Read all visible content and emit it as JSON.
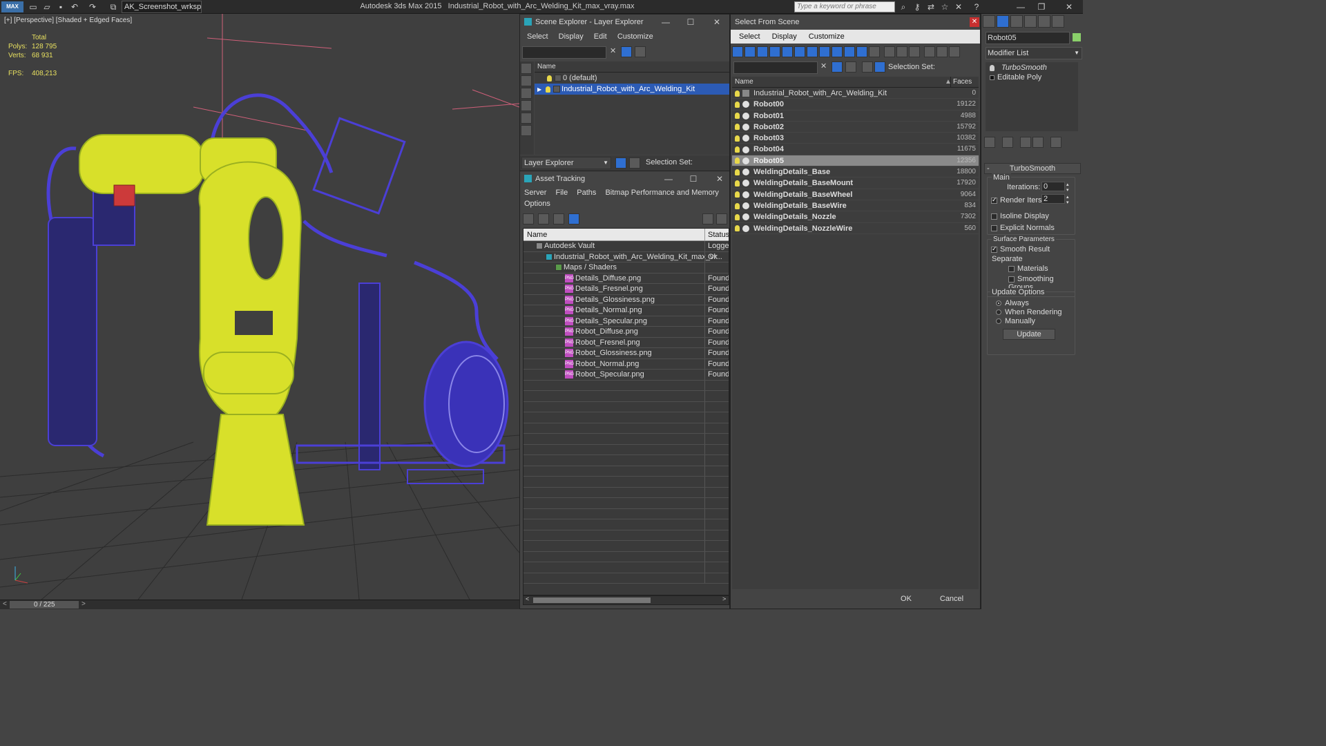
{
  "titlebar": {
    "app_logo": "MAX",
    "workspace": "AK_Screenshot_wrksp",
    "app_title": "Autodesk 3ds Max  2015",
    "file_title": "Industrial_Robot_with_Arc_Welding_Kit_max_vray.max",
    "search_placeholder": "Type a keyword or phrase"
  },
  "viewport": {
    "label": "[+] [Perspective] [Shaded + Edged Faces]",
    "stats_header": "Total",
    "polys_label": "Polys:",
    "polys_value": "128 795",
    "verts_label": "Verts:",
    "verts_value": "68 931",
    "fps_label": "FPS:",
    "fps_value": "408,213"
  },
  "timeline": {
    "frame": "0 / 225"
  },
  "scene_explorer": {
    "title": "Scene Explorer - Layer Explorer",
    "menus": [
      "Select",
      "Display",
      "Edit",
      "Customize"
    ],
    "column_name": "Name",
    "layers": [
      "0 (default)",
      "Industrial_Robot_with_Arc_Welding_Kit"
    ],
    "footer_dropdown": "Layer Explorer",
    "footer_selection_set": "Selection Set:"
  },
  "asset_tracking": {
    "title": "Asset Tracking",
    "menus": [
      "Server",
      "File",
      "Paths",
      "Bitmap Performance and Memory",
      "Options"
    ],
    "col_name": "Name",
    "col_status": "Status",
    "rows": [
      {
        "name": "Autodesk Vault",
        "status": "Logged",
        "indent": 0
      },
      {
        "name": "Industrial_Robot_with_Arc_Welding_Kit_max_vr...",
        "status": "Ok",
        "indent": 1
      },
      {
        "name": "Maps / Shaders",
        "status": "",
        "indent": 2
      },
      {
        "name": "Details_Diffuse.png",
        "status": "Found",
        "indent": 3
      },
      {
        "name": "Details_Fresnel.png",
        "status": "Found",
        "indent": 3
      },
      {
        "name": "Details_Glossiness.png",
        "status": "Found",
        "indent": 3
      },
      {
        "name": "Details_Normal.png",
        "status": "Found",
        "indent": 3
      },
      {
        "name": "Details_Specular.png",
        "status": "Found",
        "indent": 3
      },
      {
        "name": "Robot_Diffuse.png",
        "status": "Found",
        "indent": 3
      },
      {
        "name": "Robot_Fresnel.png",
        "status": "Found",
        "indent": 3
      },
      {
        "name": "Robot_Glossiness.png",
        "status": "Found",
        "indent": 3
      },
      {
        "name": "Robot_Normal.png",
        "status": "Found",
        "indent": 3
      },
      {
        "name": "Robot_Specular.png",
        "status": "Found",
        "indent": 3
      }
    ]
  },
  "select_from_scene": {
    "title": "Select From Scene",
    "menus": [
      "Select",
      "Display",
      "Customize"
    ],
    "selection_set": "Selection Set:",
    "col_name": "Name",
    "col_faces": "Faces",
    "rows": [
      {
        "name": "Industrial_Robot_with_Arc_Welding_Kit",
        "faces": "0",
        "selected": false,
        "bold": false
      },
      {
        "name": "Robot00",
        "faces": "19122",
        "selected": false,
        "bold": true
      },
      {
        "name": "Robot01",
        "faces": "4988",
        "selected": false,
        "bold": true
      },
      {
        "name": "Robot02",
        "faces": "15792",
        "selected": false,
        "bold": true
      },
      {
        "name": "Robot03",
        "faces": "10382",
        "selected": false,
        "bold": true
      },
      {
        "name": "Robot04",
        "faces": "11675",
        "selected": false,
        "bold": true
      },
      {
        "name": "Robot05",
        "faces": "12356",
        "selected": true,
        "bold": true
      },
      {
        "name": "WeldingDetails_Base",
        "faces": "18800",
        "selected": false,
        "bold": true
      },
      {
        "name": "WeldingDetails_BaseMount",
        "faces": "17920",
        "selected": false,
        "bold": true
      },
      {
        "name": "WeldingDetails_BaseWheel",
        "faces": "9064",
        "selected": false,
        "bold": true
      },
      {
        "name": "WeldingDetails_BaseWire",
        "faces": "834",
        "selected": false,
        "bold": true
      },
      {
        "name": "WeldingDetails_Nozzle",
        "faces": "7302",
        "selected": false,
        "bold": true
      },
      {
        "name": "WeldingDetails_NozzleWire",
        "faces": "560",
        "selected": false,
        "bold": true
      }
    ],
    "ok": "OK",
    "cancel": "Cancel"
  },
  "command_panel": {
    "object_name": "Robot05",
    "modifier_list": "Modifier List",
    "stack": [
      "TurboSmooth",
      "Editable Poly"
    ],
    "rollout_title": "TurboSmooth",
    "main_label": "Main",
    "iterations_label": "Iterations:",
    "iterations_value": "0",
    "render_iters_label": "Render Iters:",
    "render_iters_value": "2",
    "isoline": "Isoline Display",
    "explicit_normals": "Explicit Normals",
    "surface_params": "Surface Parameters",
    "smooth_result": "Smooth Result",
    "separate": "Separate",
    "materials": "Materials",
    "smoothing_groups": "Smoothing Groups",
    "update_options": "Update Options",
    "always": "Always",
    "when_rendering": "When Rendering",
    "manually": "Manually",
    "update_button": "Update"
  },
  "colors": {
    "robot_yellow": "#d8e02a",
    "wire_blue": "#4b3fd6",
    "selection_blue": "#2c5bb5",
    "grid": "#2a2a2a"
  }
}
